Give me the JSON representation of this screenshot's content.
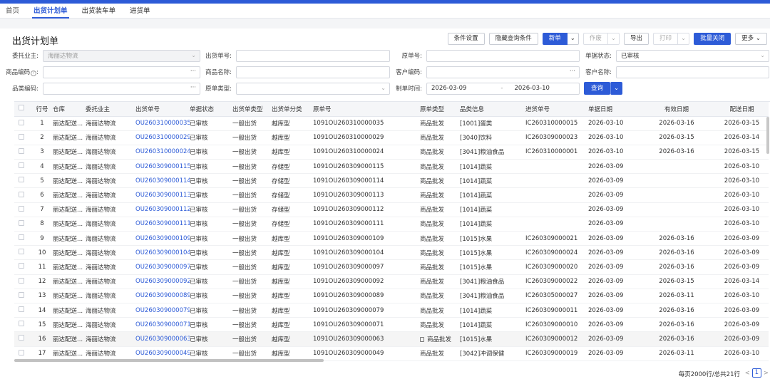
{
  "tabs": [
    "首页",
    "出货计划单",
    "出货装车单",
    "进货单"
  ],
  "active_tab": 1,
  "page_title": "出货计划单",
  "toolbar": {
    "condition_settings": "条件设置",
    "hide_conditions": "隐藏查询条件",
    "new": "新单",
    "void": "作废",
    "export": "导出",
    "print": "打印",
    "batch_close": "批量关闭",
    "more": "更多"
  },
  "form": {
    "consignor": {
      "label": "委托业主:",
      "value": "海丽达物流"
    },
    "ship_no": {
      "label": "出货单号:",
      "value": ""
    },
    "orig_no": {
      "label": "原单号:",
      "value": ""
    },
    "doc_status": {
      "label": "单据状态:",
      "value": "已审核"
    },
    "item_code": {
      "label": "商品编码",
      "value": ""
    },
    "item_name": {
      "label": "商品名称:",
      "value": ""
    },
    "cust_code": {
      "label": "客户编码:",
      "value": ""
    },
    "cust_name": {
      "label": "客户名称:",
      "value": ""
    },
    "cat_code": {
      "label": "品类编码:",
      "value": ""
    },
    "orig_type": {
      "label": "原单类型:",
      "value": ""
    },
    "make_time": {
      "label": "制单时间:",
      "from": "2026-03-09",
      "sep": "-",
      "to": "2026-03-10"
    },
    "query": "查询",
    "dots": "···"
  },
  "columns": [
    "行号",
    "仓库",
    "委托业主",
    "出货单号",
    "单据状态",
    "出货单类型",
    "出货单分类",
    "原单号",
    "原单类型",
    "品类信息",
    "进货单号",
    "单据日期",
    "有效日期",
    "配送日期"
  ],
  "rows": [
    [
      "1",
      "丽达配送...",
      "海丽达物流",
      "OU260310000035",
      "已审核",
      "一般出货",
      "越库型",
      "1091OU260310000035",
      "商品批发",
      "[1001]蛋类",
      "IC260310000015",
      "2026-03-10",
      "2026-03-16",
      "2026-03-15"
    ],
    [
      "2",
      "丽达配送...",
      "海丽达物流",
      "OU260310000029",
      "已审核",
      "一般出货",
      "越库型",
      "1091OU260310000029",
      "商品批发",
      "[3040]饮料",
      "IC260309000023",
      "2026-03-10",
      "2026-03-15",
      "2026-03-14"
    ],
    [
      "3",
      "丽达配送...",
      "海丽达物流",
      "OU260310000024",
      "已审核",
      "一般出货",
      "越库型",
      "1091OU260310000024",
      "商品批发",
      "[3041]粮油食品",
      "IC260310000001",
      "2026-03-10",
      "2026-03-16",
      "2026-03-15"
    ],
    [
      "4",
      "丽达配送...",
      "海丽达物流",
      "OU260309000115",
      "已审核",
      "一般出货",
      "存储型",
      "1091OU260309000115",
      "商品批发",
      "[1014]蔬菜",
      "",
      "2026-03-09",
      "",
      "2026-03-10"
    ],
    [
      "5",
      "丽达配送...",
      "海丽达物流",
      "OU260309000114",
      "已审核",
      "一般出货",
      "存储型",
      "1091OU260309000114",
      "商品批发",
      "[1014]蔬菜",
      "",
      "2026-03-09",
      "",
      "2026-03-10"
    ],
    [
      "6",
      "丽达配送...",
      "海丽达物流",
      "OU260309000113",
      "已审核",
      "一般出货",
      "存储型",
      "1091OU260309000113",
      "商品批发",
      "[1014]蔬菜",
      "",
      "2026-03-09",
      "",
      "2026-03-10"
    ],
    [
      "7",
      "丽达配送...",
      "海丽达物流",
      "OU260309000112",
      "已审核",
      "一般出货",
      "存储型",
      "1091OU260309000112",
      "商品批发",
      "[1014]蔬菜",
      "",
      "2026-03-09",
      "",
      "2026-03-10"
    ],
    [
      "8",
      "丽达配送...",
      "海丽达物流",
      "OU260309000111",
      "已审核",
      "一般出货",
      "存储型",
      "1091OU260309000111",
      "商品批发",
      "[1014]蔬菜",
      "",
      "2026-03-09",
      "",
      "2026-03-10"
    ],
    [
      "9",
      "丽达配送...",
      "海丽达物流",
      "OU260309000109",
      "已审核",
      "一般出货",
      "越库型",
      "1091OU260309000109",
      "商品批发",
      "[1015]水果",
      "IC260309000021",
      "2026-03-09",
      "2026-03-16",
      "2026-03-09"
    ],
    [
      "10",
      "丽达配送...",
      "海丽达物流",
      "OU260309000104",
      "已审核",
      "一般出货",
      "越库型",
      "1091OU260309000104",
      "商品批发",
      "[1015]水果",
      "IC260309000024",
      "2026-03-09",
      "2026-03-16",
      "2026-03-09"
    ],
    [
      "11",
      "丽达配送...",
      "海丽达物流",
      "OU260309000097",
      "已审核",
      "一般出货",
      "越库型",
      "1091OU260309000097",
      "商品批发",
      "[1015]水果",
      "IC260309000020",
      "2026-03-09",
      "2026-03-16",
      "2026-03-09"
    ],
    [
      "12",
      "丽达配送...",
      "海丽达物流",
      "OU260309000092",
      "已审核",
      "一般出货",
      "越库型",
      "1091OU260309000092",
      "商品批发",
      "[3041]粮油食品",
      "IC260309000022",
      "2026-03-09",
      "2026-03-15",
      "2026-03-14"
    ],
    [
      "13",
      "丽达配送...",
      "海丽达物流",
      "OU260309000089",
      "已审核",
      "一般出货",
      "越库型",
      "1091OU260309000089",
      "商品批发",
      "[3041]粮油食品",
      "IC260305000027",
      "2026-03-09",
      "2026-03-11",
      "2026-03-10"
    ],
    [
      "14",
      "丽达配送...",
      "海丽达物流",
      "OU260309000079",
      "已审核",
      "一般出货",
      "越库型",
      "1091OU260309000079",
      "商品批发",
      "[1014]蔬菜",
      "IC260309000011",
      "2026-03-09",
      "2026-03-16",
      "2026-03-09"
    ],
    [
      "15",
      "丽达配送...",
      "海丽达物流",
      "OU260309000071",
      "已审核",
      "一般出货",
      "越库型",
      "1091OU260309000071",
      "商品批发",
      "[1014]蔬菜",
      "IC260309000010",
      "2026-03-09",
      "2026-03-16",
      "2026-03-09"
    ],
    [
      "16",
      "丽达配送...",
      "海丽达物流",
      "OU260309000063",
      "已审核",
      "一般出货",
      "越库型",
      "1091OU260309000063",
      "商品批发",
      "[1015]水果",
      "IC260309000012",
      "2026-03-09",
      "2026-03-16",
      "2026-03-09"
    ],
    [
      "17",
      "丽达配送...",
      "海丽达物流",
      "OU260309000049",
      "已审核",
      "一般出货",
      "越库型",
      "1091OU260309000049",
      "商品批发",
      "[3042]冲调保健",
      "IC260309000019",
      "2026-03-09",
      "2026-03-11",
      "2026-03-10"
    ]
  ],
  "highlight_row": 16,
  "footer": {
    "info": "每页2000行/总共21行",
    "page": "1",
    "prev": "<",
    "next": ">"
  },
  "colors": {
    "accent": "#2d5bd7"
  }
}
